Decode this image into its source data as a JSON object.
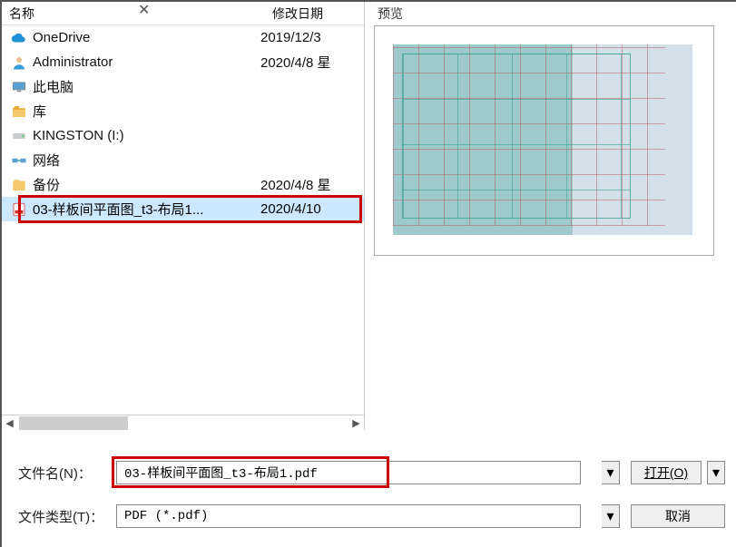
{
  "headers": {
    "name": "名称",
    "date": "修改日期"
  },
  "preview_label": "预览",
  "rows": [
    {
      "icon": "cloud",
      "name": "OneDrive",
      "date": "2019/12/3"
    },
    {
      "icon": "user",
      "name": "Administrator",
      "date": "2020/4/8 星"
    },
    {
      "icon": "pc",
      "name": "此电脑",
      "date": ""
    },
    {
      "icon": "lib",
      "name": "库",
      "date": ""
    },
    {
      "icon": "drive",
      "name": "KINGSTON (I:)",
      "date": ""
    },
    {
      "icon": "net",
      "name": "网络",
      "date": ""
    },
    {
      "icon": "folder",
      "name": "备份",
      "date": "2020/4/8 星"
    },
    {
      "icon": "pdf",
      "name": "03-样板间平面图_t3-布局1...",
      "date": "2020/4/10",
      "selected": true
    }
  ],
  "form": {
    "filename_label": "文件名(N)：",
    "filetype_label": "文件类型(T)：",
    "filename_value": "03-样板间平面图_t3-布局1.pdf",
    "filetype_value": "PDF (*.pdf)",
    "open_label": "打开(O)",
    "cancel_label": "取消"
  }
}
